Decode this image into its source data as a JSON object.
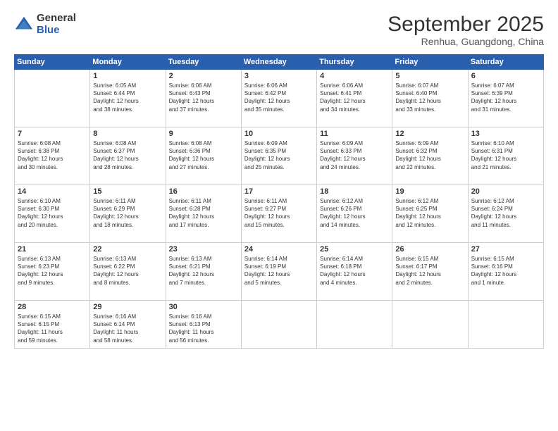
{
  "logo": {
    "general": "General",
    "blue": "Blue"
  },
  "header": {
    "month": "September 2025",
    "location": "Renhua, Guangdong, China"
  },
  "days_of_week": [
    "Sunday",
    "Monday",
    "Tuesday",
    "Wednesday",
    "Thursday",
    "Friday",
    "Saturday"
  ],
  "weeks": [
    [
      {
        "day": "",
        "info": ""
      },
      {
        "day": "1",
        "info": "Sunrise: 6:05 AM\nSunset: 6:44 PM\nDaylight: 12 hours\nand 38 minutes."
      },
      {
        "day": "2",
        "info": "Sunrise: 6:06 AM\nSunset: 6:43 PM\nDaylight: 12 hours\nand 37 minutes."
      },
      {
        "day": "3",
        "info": "Sunrise: 6:06 AM\nSunset: 6:42 PM\nDaylight: 12 hours\nand 35 minutes."
      },
      {
        "day": "4",
        "info": "Sunrise: 6:06 AM\nSunset: 6:41 PM\nDaylight: 12 hours\nand 34 minutes."
      },
      {
        "day": "5",
        "info": "Sunrise: 6:07 AM\nSunset: 6:40 PM\nDaylight: 12 hours\nand 33 minutes."
      },
      {
        "day": "6",
        "info": "Sunrise: 6:07 AM\nSunset: 6:39 PM\nDaylight: 12 hours\nand 31 minutes."
      }
    ],
    [
      {
        "day": "7",
        "info": "Sunrise: 6:08 AM\nSunset: 6:38 PM\nDaylight: 12 hours\nand 30 minutes."
      },
      {
        "day": "8",
        "info": "Sunrise: 6:08 AM\nSunset: 6:37 PM\nDaylight: 12 hours\nand 28 minutes."
      },
      {
        "day": "9",
        "info": "Sunrise: 6:08 AM\nSunset: 6:36 PM\nDaylight: 12 hours\nand 27 minutes."
      },
      {
        "day": "10",
        "info": "Sunrise: 6:09 AM\nSunset: 6:35 PM\nDaylight: 12 hours\nand 25 minutes."
      },
      {
        "day": "11",
        "info": "Sunrise: 6:09 AM\nSunset: 6:33 PM\nDaylight: 12 hours\nand 24 minutes."
      },
      {
        "day": "12",
        "info": "Sunrise: 6:09 AM\nSunset: 6:32 PM\nDaylight: 12 hours\nand 22 minutes."
      },
      {
        "day": "13",
        "info": "Sunrise: 6:10 AM\nSunset: 6:31 PM\nDaylight: 12 hours\nand 21 minutes."
      }
    ],
    [
      {
        "day": "14",
        "info": "Sunrise: 6:10 AM\nSunset: 6:30 PM\nDaylight: 12 hours\nand 20 minutes."
      },
      {
        "day": "15",
        "info": "Sunrise: 6:11 AM\nSunset: 6:29 PM\nDaylight: 12 hours\nand 18 minutes."
      },
      {
        "day": "16",
        "info": "Sunrise: 6:11 AM\nSunset: 6:28 PM\nDaylight: 12 hours\nand 17 minutes."
      },
      {
        "day": "17",
        "info": "Sunrise: 6:11 AM\nSunset: 6:27 PM\nDaylight: 12 hours\nand 15 minutes."
      },
      {
        "day": "18",
        "info": "Sunrise: 6:12 AM\nSunset: 6:26 PM\nDaylight: 12 hours\nand 14 minutes."
      },
      {
        "day": "19",
        "info": "Sunrise: 6:12 AM\nSunset: 6:25 PM\nDaylight: 12 hours\nand 12 minutes."
      },
      {
        "day": "20",
        "info": "Sunrise: 6:12 AM\nSunset: 6:24 PM\nDaylight: 12 hours\nand 11 minutes."
      }
    ],
    [
      {
        "day": "21",
        "info": "Sunrise: 6:13 AM\nSunset: 6:23 PM\nDaylight: 12 hours\nand 9 minutes."
      },
      {
        "day": "22",
        "info": "Sunrise: 6:13 AM\nSunset: 6:22 PM\nDaylight: 12 hours\nand 8 minutes."
      },
      {
        "day": "23",
        "info": "Sunrise: 6:13 AM\nSunset: 6:21 PM\nDaylight: 12 hours\nand 7 minutes."
      },
      {
        "day": "24",
        "info": "Sunrise: 6:14 AM\nSunset: 6:19 PM\nDaylight: 12 hours\nand 5 minutes."
      },
      {
        "day": "25",
        "info": "Sunrise: 6:14 AM\nSunset: 6:18 PM\nDaylight: 12 hours\nand 4 minutes."
      },
      {
        "day": "26",
        "info": "Sunrise: 6:15 AM\nSunset: 6:17 PM\nDaylight: 12 hours\nand 2 minutes."
      },
      {
        "day": "27",
        "info": "Sunrise: 6:15 AM\nSunset: 6:16 PM\nDaylight: 12 hours\nand 1 minute."
      }
    ],
    [
      {
        "day": "28",
        "info": "Sunrise: 6:15 AM\nSunset: 6:15 PM\nDaylight: 11 hours\nand 59 minutes."
      },
      {
        "day": "29",
        "info": "Sunrise: 6:16 AM\nSunset: 6:14 PM\nDaylight: 11 hours\nand 58 minutes."
      },
      {
        "day": "30",
        "info": "Sunrise: 6:16 AM\nSunset: 6:13 PM\nDaylight: 11 hours\nand 56 minutes."
      },
      {
        "day": "",
        "info": ""
      },
      {
        "day": "",
        "info": ""
      },
      {
        "day": "",
        "info": ""
      },
      {
        "day": "",
        "info": ""
      }
    ]
  ]
}
